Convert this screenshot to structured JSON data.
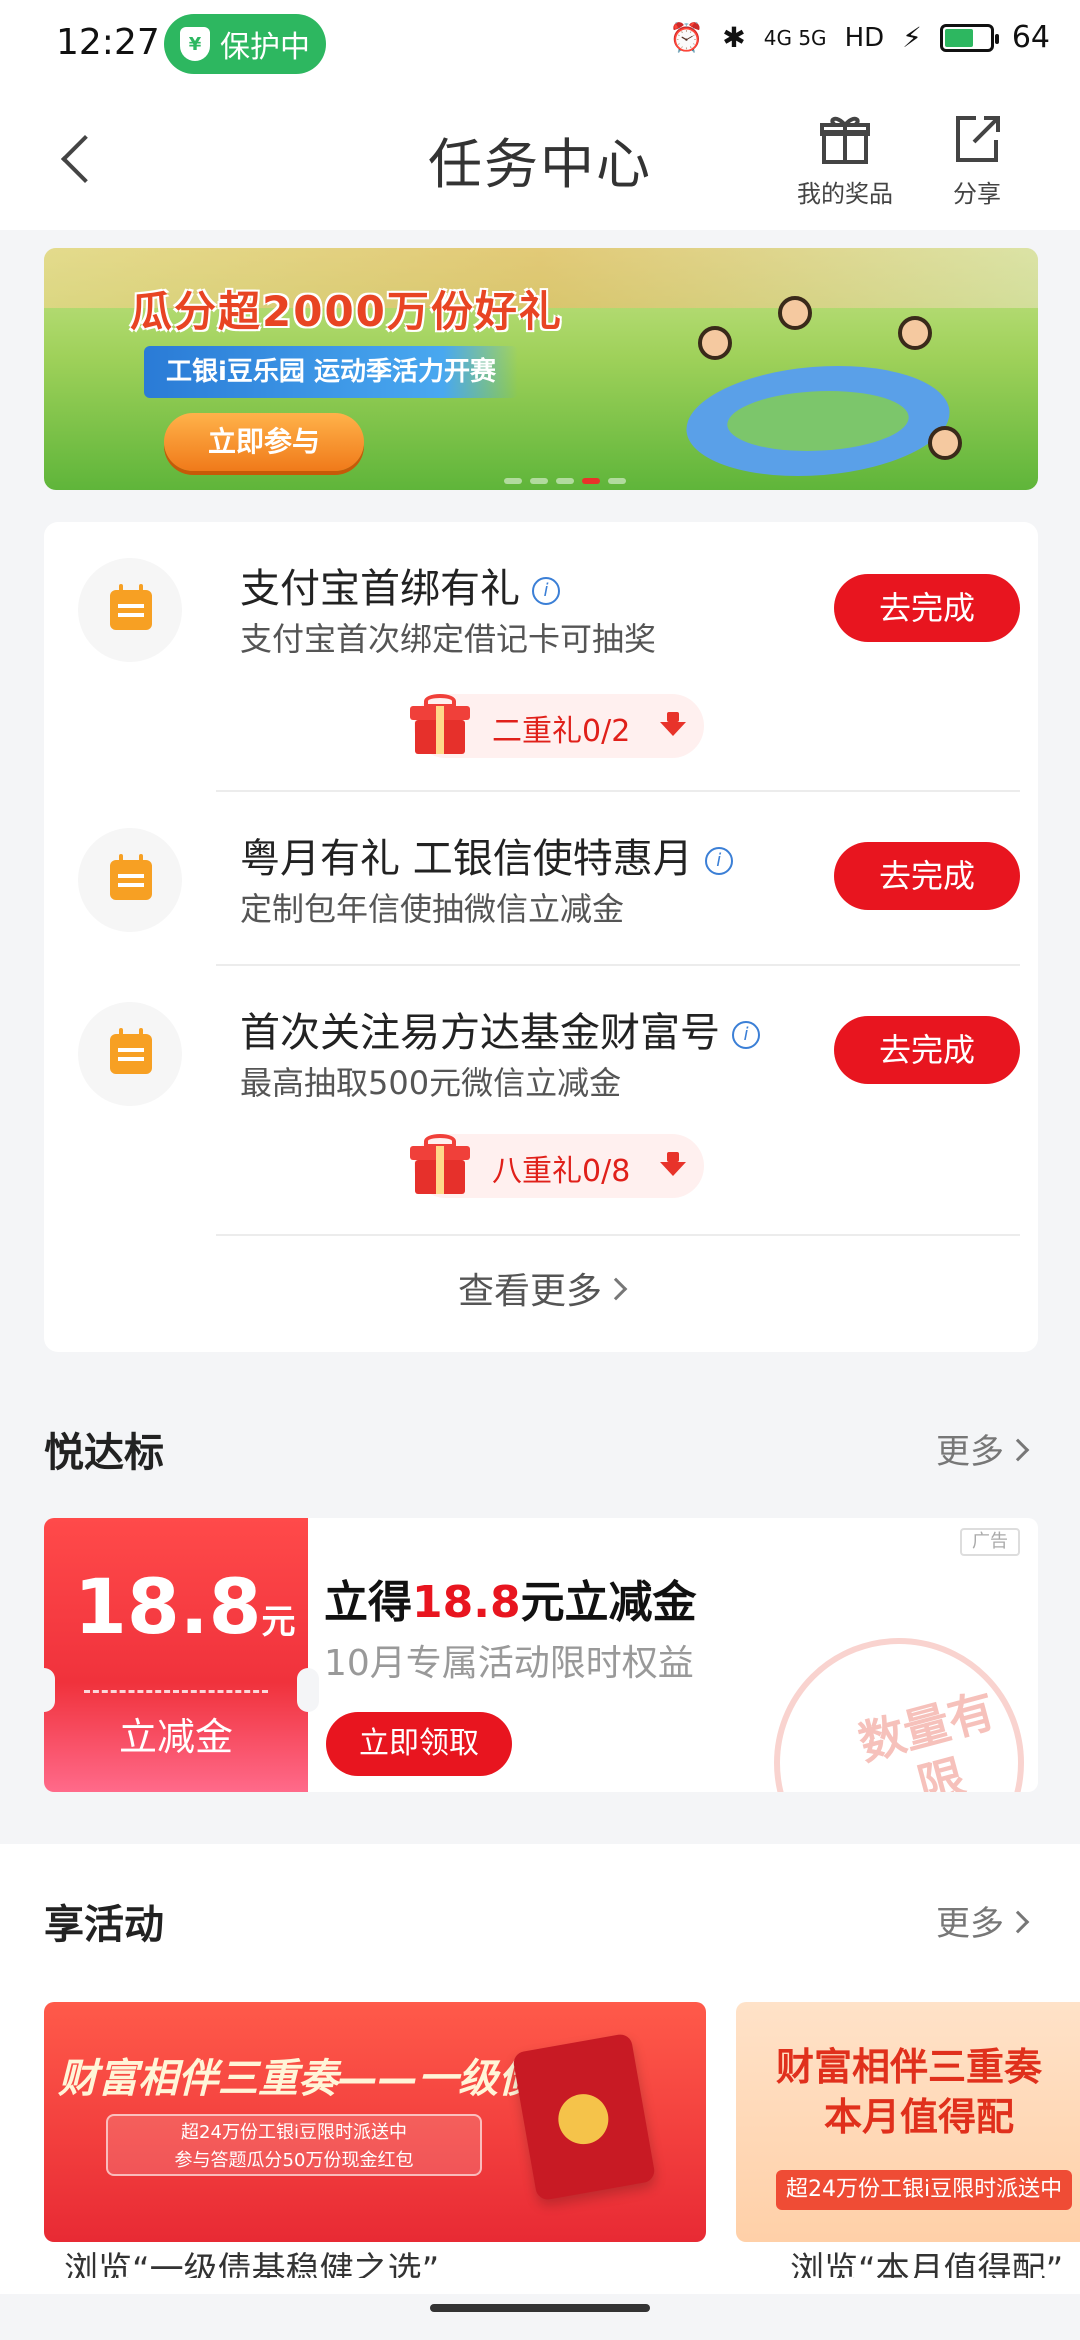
{
  "status_bar": {
    "time": "12:27",
    "protect_label": "保护中",
    "network": "4G 5G",
    "hd": "HD",
    "battery": "64"
  },
  "header": {
    "title": "任务中心",
    "my_prizes": "我的奖品",
    "share": "分享"
  },
  "banner": {
    "headline": "瓜分超2000万份好礼",
    "subline": "工银i豆乐园 运动季活力开赛",
    "button": "立即参与",
    "slides": 5,
    "active_slide": 4
  },
  "tasks": [
    {
      "title": "支付宝首绑有礼",
      "desc": "支付宝首次绑定借记卡可抽奖",
      "button": "去完成",
      "gift": "二重礼0/2"
    },
    {
      "title": "粤月有礼 工银信使特惠月",
      "desc": "定制包年信使抽微信立减金",
      "button": "去完成",
      "gift": null
    },
    {
      "title": "首次关注易方达基金财富号",
      "desc": "最高抽取500元微信立减金",
      "button": "去完成",
      "gift": "八重礼0/8"
    }
  ],
  "tasks_more": "查看更多",
  "yue_da_biao": {
    "title": "悦达标",
    "more": "更多",
    "coupon": {
      "amount": "18.8",
      "unit": "元",
      "kind": "立减金",
      "ad": "广告",
      "title_prefix": "立得",
      "title_amount": "18.8",
      "title_suffix": "元立减金",
      "subtitle": "10月专属活动限时权益",
      "button": "立即领取",
      "stamp": "数量有限"
    }
  },
  "activities": {
    "title": "享活动",
    "more": "更多",
    "items": [
      {
        "title": "财富相伴三重奏——一级债基",
        "line1": "超24万份工银i豆限时派送中",
        "line2": "参与答题瓜分50万份现金红包",
        "caption": "浏览“一级债基稳健之选”"
      },
      {
        "title_line1": "财富相伴三重奏",
        "title_line2": "本月值得配",
        "bar": "超24万份工银i豆限时派送中",
        "caption": "浏览“本月值得配”"
      }
    ]
  },
  "colors": {
    "primary_red": "#e8151f",
    "protect_green": "#2db760",
    "calendar_orange": "#f7a023"
  }
}
